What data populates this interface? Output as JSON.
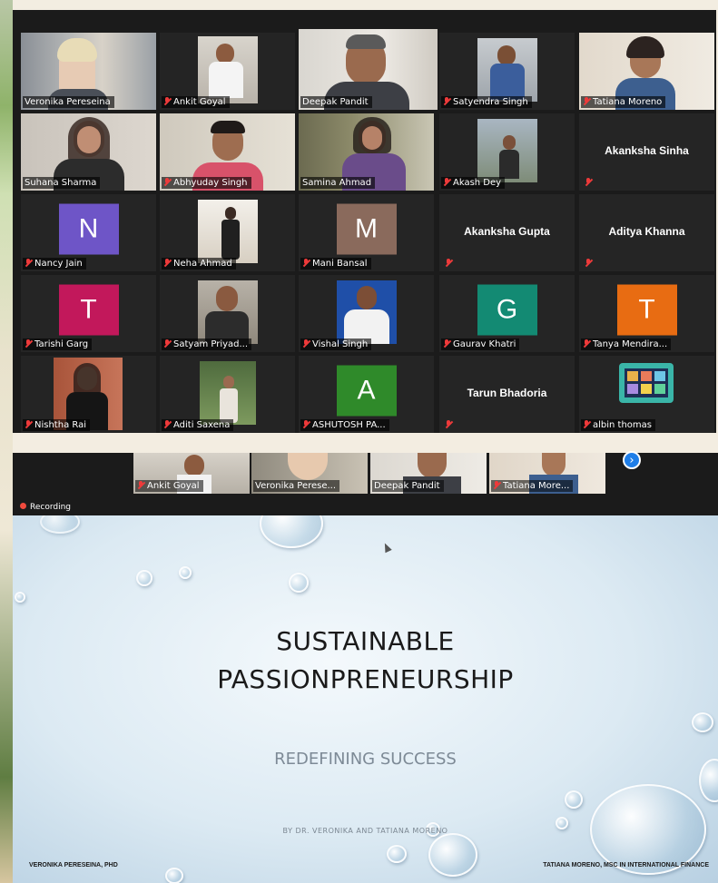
{
  "gallery": {
    "tiles": [
      {
        "name": "Veronika Pereseina"
      },
      {
        "name": "Ankit Goyal"
      },
      {
        "name": "Deepak Pandit"
      },
      {
        "name": "Satyendra Singh"
      },
      {
        "name": "Tatiana Moreno"
      },
      {
        "name": "Suhana Sharma"
      },
      {
        "name": "Abhyuday Singh"
      },
      {
        "name": "Samina Ahmad"
      },
      {
        "name": "Akash Dey"
      },
      {
        "name": "Akanksha Sinha"
      },
      {
        "name": "Nancy Jain",
        "initial": "N",
        "color": "#6e55c7"
      },
      {
        "name": "Neha Ahmad"
      },
      {
        "name": "Mani Bansal",
        "initial": "M",
        "color": "#8a6a5c"
      },
      {
        "name": "Akanksha Gupta"
      },
      {
        "name": "Aditya Khanna"
      },
      {
        "name": "Tarishi Garg",
        "initial": "T",
        "color": "#c2185b"
      },
      {
        "name": "Satyam Priyad..."
      },
      {
        "name": "Vishal Singh"
      },
      {
        "name": "Gaurav Khatri",
        "initial": "G",
        "color": "#138a73"
      },
      {
        "name": "Tanya Mendira...",
        "initial": "T",
        "color": "#e86c12"
      },
      {
        "name": "Nishtha Rai"
      },
      {
        "name": "Aditi Saxena"
      },
      {
        "name": "ASHUTOSH PA...",
        "initial": "A",
        "color": "#2f8a2a"
      },
      {
        "name": "Tarun Bhadoria"
      },
      {
        "name": "albin thomas"
      }
    ]
  },
  "share": {
    "strip": [
      "Ankit Goyal",
      "Veronika Perese...",
      "Deepak Pandit",
      "Tatiana More..."
    ],
    "recording_label": "Recording",
    "slide": {
      "title_line1": "SUSTAINABLE",
      "title_line2": "PASSIONPRENEURSHIP",
      "subtitle": "REDEFINING SUCCESS",
      "byline": "BY DR. VERONIKA AND TATIANA MORENO",
      "footer_left": "VERONIKA PERESEINA, PHD",
      "footer_right": "TATIANA MORENO, MSC IN INTERNATIONAL FINANCE"
    }
  }
}
